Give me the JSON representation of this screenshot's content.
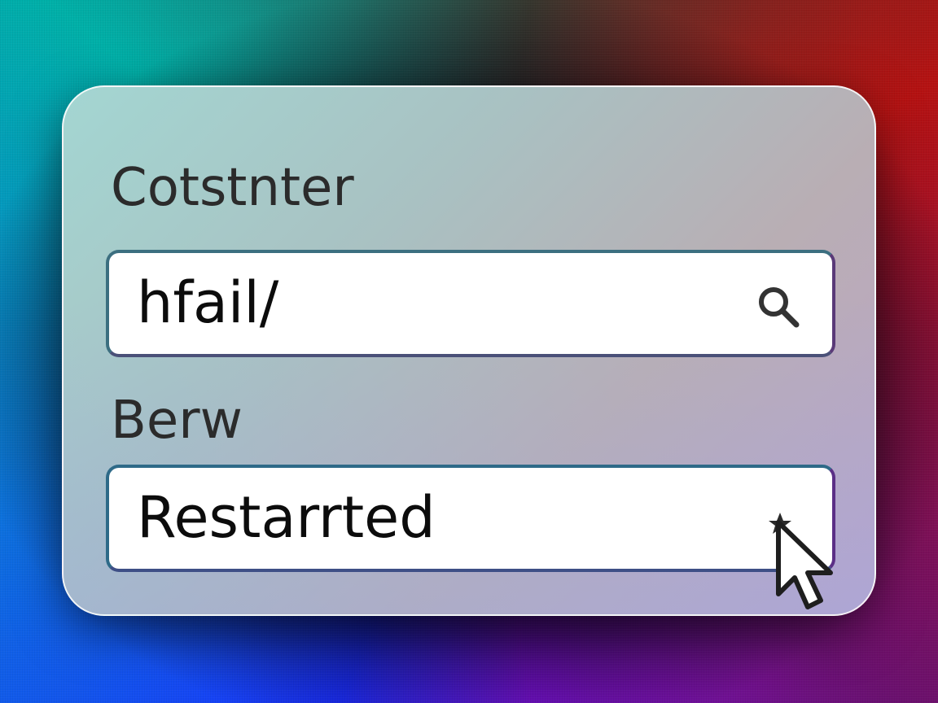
{
  "form": {
    "field1_label": "Cotstnter",
    "field1_value": "hfail/",
    "field1_icon": "search-icon",
    "field2_label": "Berw",
    "field2_value": "Restarrted",
    "cursor_icon": "pointer-cursor-icon"
  },
  "colors": {
    "card_border": "#ffffff",
    "field_border": "#3d6f86",
    "text": "#2b2b2b"
  }
}
